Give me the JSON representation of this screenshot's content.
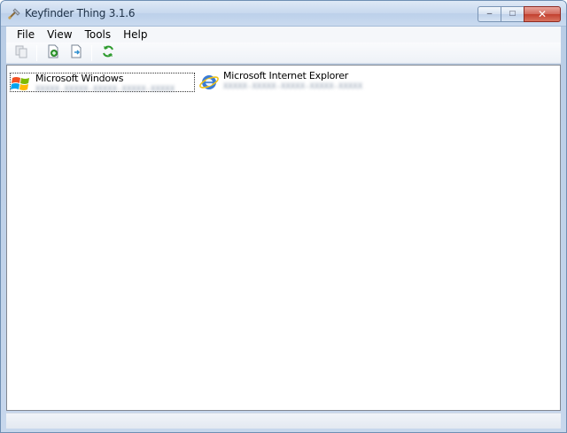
{
  "window": {
    "title": "Keyfinder Thing 3.1.6",
    "caption_minimize": "–",
    "caption_maximize": "□",
    "caption_close": "✕"
  },
  "menu": {
    "file": "File",
    "view": "View",
    "tools": "Tools",
    "help": "Help"
  },
  "toolbar": {
    "icons": [
      "copy-icon",
      "save-icon",
      "export-icon",
      "refresh-icon"
    ]
  },
  "products": [
    {
      "name": "Microsoft Windows",
      "key": "XXXXX-XXXXX-XXXXX-XXXXX-XXXXX",
      "icon": "windows-logo-icon"
    },
    {
      "name": "Microsoft Internet Explorer",
      "key": "XXXXX-XXXXX-XXXXX-XXXXX-XXXXX",
      "icon": "internet-explorer-icon"
    }
  ],
  "colors": {
    "accent": "#3a7bd5",
    "frame": "#c9daee",
    "close": "#c2402f"
  }
}
